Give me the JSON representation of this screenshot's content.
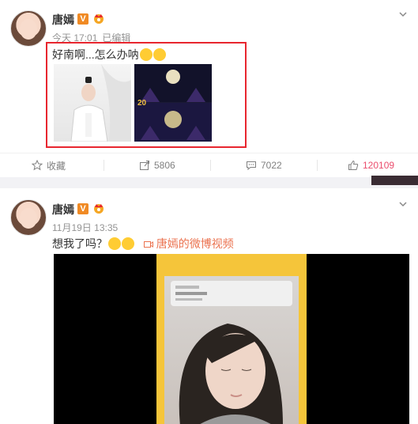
{
  "post1": {
    "user_name": "唐嫣",
    "verified_badge": "V",
    "crown_icon": "crown-icon",
    "time": "今天 17:01",
    "edited": "已编辑",
    "text": "好南啊...怎么办呐",
    "emoji": [
      "laughing-crying-emoji",
      "thinking-emoji"
    ],
    "image1_label": "Man in white robes on light background",
    "image2_label": "Dark stage with moon backdrop",
    "image2_overlay_text": "20",
    "actions": {
      "favorite_label": "收藏",
      "share_count": "5806",
      "comment_count": "7022",
      "like_count": "120109"
    }
  },
  "post2": {
    "user_name": "唐嫣",
    "verified_badge": "V",
    "time": "11月19日 13:35",
    "text": "想我了吗？",
    "emoji": [
      "thinking-emoji",
      "tongue-emoji"
    ],
    "video_link": "唐嫣的微博视频"
  },
  "colors": {
    "highlight_border": "#e8262f",
    "like_accent": "#eb4d6d",
    "video_link": "#eb7350",
    "verified_orange": "#f08a24",
    "video_frame_yellow": "#f5c53a"
  }
}
